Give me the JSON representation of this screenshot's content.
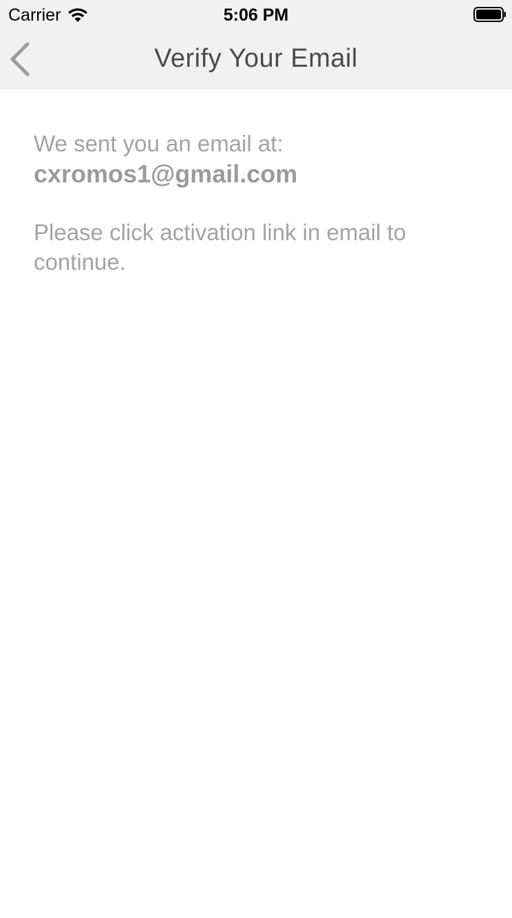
{
  "status_bar": {
    "carrier": "Carrier",
    "time": "5:06 PM",
    "wifi_icon": "wifi-icon",
    "battery_icon": "battery-full-icon"
  },
  "nav": {
    "back_icon": "chevron-left-icon",
    "title": "Verify Your Email"
  },
  "main": {
    "sent_label": "We sent you an email at:",
    "email": "cxromos1@gmail.com",
    "instruction": "Please click activation link in email to continue."
  },
  "colors": {
    "nav_background": "#f1f1f1",
    "title_text": "#4a4a4a",
    "body_text": "#a3a3a3",
    "back_chevron": "#9b9b9b"
  }
}
